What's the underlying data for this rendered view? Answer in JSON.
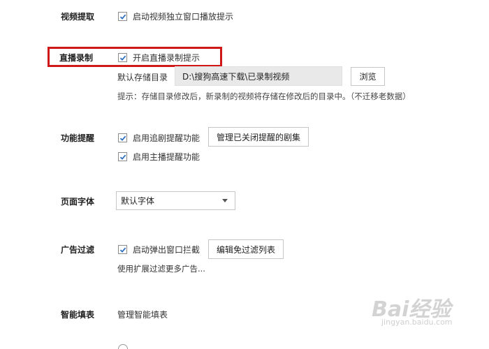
{
  "video": {
    "title": "视频提取",
    "option": "启动视频独立窗口播放提示"
  },
  "live": {
    "title": "直播录制",
    "option": "开启直播录制提示",
    "dir_label": "默认存储目录",
    "dir_value": "D:\\搜狗高速下载\\已录制视频",
    "browse": "浏览",
    "hint": "提示：存储目录修改后，新录制的视频将存储在修改后的目录中。（不迁移老数据）"
  },
  "reminder": {
    "title": "功能提醒",
    "option1": "启用追剧提醒功能",
    "manage_button": "管理已关闭提醒的剧集",
    "option2": "启用主播提醒功能"
  },
  "font": {
    "title": "页面字体",
    "selected": "默认字体"
  },
  "adfilter": {
    "title": "广告过滤",
    "option": "启动弹出窗口拦截",
    "edit_button": "编辑免过滤列表",
    "more": "使用扩展过滤更多广告..."
  },
  "autofill": {
    "title": "智能填表",
    "manage": "管理智能填表"
  },
  "watermark": {
    "text": "Bai经验",
    "url": "jingyan.baidu.com"
  },
  "colors": {
    "highlight": "#d01818",
    "checkmark": "#2d6fc0"
  }
}
